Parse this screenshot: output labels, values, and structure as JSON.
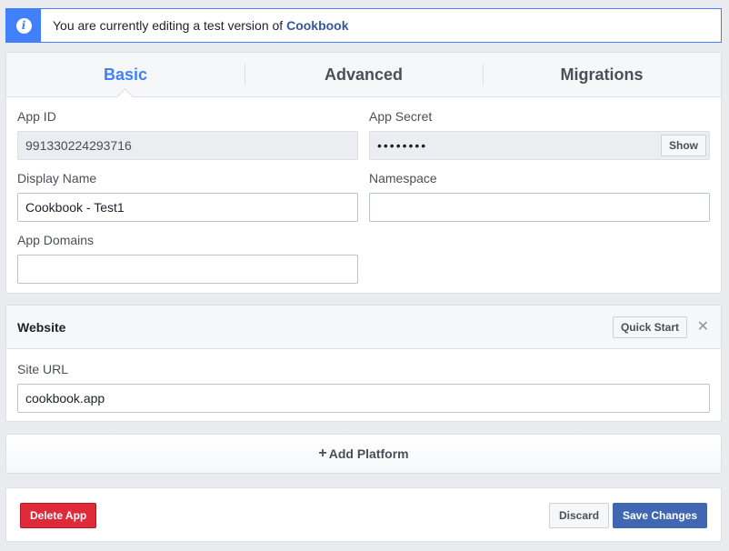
{
  "notice": {
    "icon": "info-icon",
    "text_prefix": "You are currently editing a test version of",
    "app_name": "Cookbook"
  },
  "tabs": [
    {
      "label": "Basic",
      "active": true
    },
    {
      "label": "Advanced",
      "active": false
    },
    {
      "label": "Migrations",
      "active": false
    }
  ],
  "basic": {
    "app_id_label": "App ID",
    "app_id_value": "991330224293716",
    "app_secret_label": "App Secret",
    "app_secret_value": "••••••••",
    "show_label": "Show",
    "display_name_label": "Display Name",
    "display_name_value": "Cookbook - Test1",
    "namespace_label": "Namespace",
    "namespace_value": "",
    "app_domains_label": "App Domains",
    "app_domains_value": ""
  },
  "website": {
    "title": "Website",
    "quick_start_label": "Quick Start",
    "close_icon": "close-icon",
    "site_url_label": "Site URL",
    "site_url_value": "cookbook.app"
  },
  "add_platform_label": "Add Platform",
  "footer": {
    "delete_label": "Delete App",
    "discard_label": "Discard",
    "save_label": "Save Changes"
  },
  "colors": {
    "accent": "#4080ff",
    "delete": "#e02a3a",
    "save": "#4267b2"
  }
}
